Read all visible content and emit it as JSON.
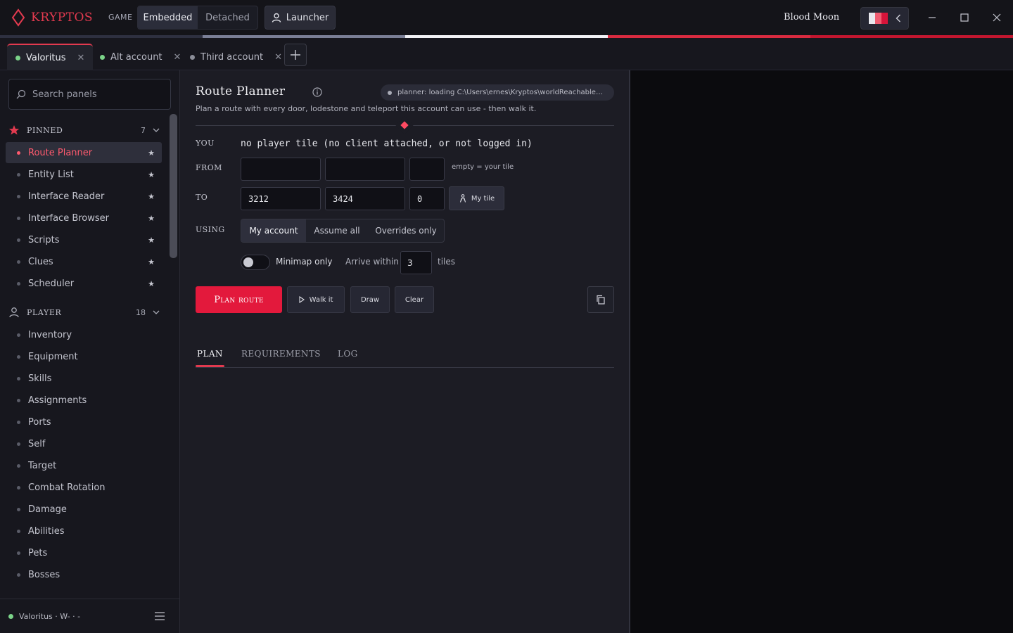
{
  "app": {
    "brand": "KRYPTOS",
    "game_label": "GAME",
    "modes": [
      "Embedded",
      "Detached"
    ],
    "active_mode": "Embedded",
    "launcher_label": "Launcher",
    "theme_name": "Blood Moon",
    "theme_swatch_colors": [
      "#e8e8ee",
      "#f05d72",
      "#d7143a"
    ],
    "brand_color": "#e23a4f",
    "accent_color": "#e3193c"
  },
  "accounts": {
    "tabs": [
      {
        "label": "Valoritus",
        "status_color": "#7bd389",
        "active": true
      },
      {
        "label": "Alt account",
        "status_color": "#7bd389",
        "active": false
      },
      {
        "label": "Third account",
        "status_color": "#8b8d98",
        "active": false
      }
    ]
  },
  "sidebar": {
    "search_placeholder": "Search panels",
    "pinned": {
      "title": "PINNED",
      "count": "7",
      "items": [
        {
          "label": "Route Planner",
          "active": true
        },
        {
          "label": "Entity List"
        },
        {
          "label": "Interface Reader"
        },
        {
          "label": "Interface Browser"
        },
        {
          "label": "Scripts"
        },
        {
          "label": "Clues"
        },
        {
          "label": "Scheduler"
        }
      ]
    },
    "player": {
      "title": "PLAYER",
      "count": "18",
      "items": [
        {
          "label": "Inventory"
        },
        {
          "label": "Equipment"
        },
        {
          "label": "Skills"
        },
        {
          "label": "Assignments"
        },
        {
          "label": "Ports"
        },
        {
          "label": "Self"
        },
        {
          "label": "Target"
        },
        {
          "label": "Combat Rotation"
        },
        {
          "label": "Damage"
        },
        {
          "label": "Abilities"
        },
        {
          "label": "Pets"
        },
        {
          "label": "Bosses"
        }
      ]
    },
    "footer_account": "Valoritus · W- · -"
  },
  "panel": {
    "title": "Route Planner",
    "status": "planner: loading C:\\Users\\ernes\\Kryptos\\worldReachableT...",
    "description": "Plan a route with every door, lodestone and teleport this account can use - then walk it.",
    "you_label": "YOU",
    "you_value": "no player tile (no client attached, or not logged in)",
    "from_label": "FROM",
    "from": {
      "x": "",
      "y": "",
      "plane": ""
    },
    "from_hint": "empty = your tile",
    "to_label": "TO",
    "to": {
      "x": "3212",
      "y": "3424",
      "plane": "0"
    },
    "my_tile_label": "My tile",
    "using_label": "USING",
    "using_options": [
      "My account",
      "Assume all",
      "Overrides only"
    ],
    "using_selected": "My account",
    "minimap_only_label": "Minimap only",
    "minimap_only": false,
    "arrive_within_label": "Arrive within",
    "arrive_within_value": "3",
    "tiles_label": "tiles",
    "plan_button": "Plan route",
    "walk_button": "Walk it",
    "draw_button": "Draw",
    "clear_button": "Clear",
    "result_tabs": [
      "PLAN",
      "REQUIREMENTS",
      "LOG"
    ],
    "active_result_tab": "PLAN"
  }
}
